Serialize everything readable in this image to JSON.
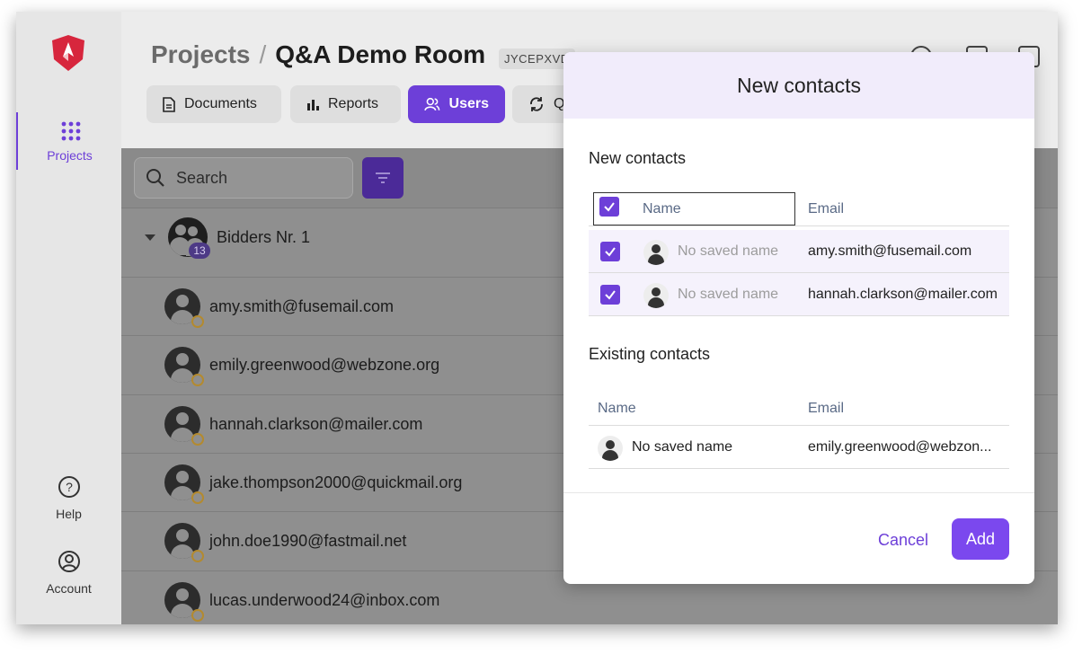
{
  "sidebar": {
    "logo": "shield-logo",
    "items": [
      {
        "label": "Projects",
        "icon": "grid-icon",
        "active": true
      },
      {
        "label": "Help",
        "icon": "help-circle-icon"
      },
      {
        "label": "Account",
        "icon": "account-circle-icon"
      }
    ]
  },
  "header": {
    "breadcrumb_root": "Projects",
    "breadcrumb_sep": "/",
    "room_name": "Q&A Demo Room",
    "room_code": "JYCEPXVD",
    "tabs": [
      {
        "label": "Documents",
        "icon": "document-icon"
      },
      {
        "label": "Reports",
        "icon": "bar-chart-icon"
      },
      {
        "label": "Users",
        "icon": "users-icon",
        "active": true
      },
      {
        "label": "Q",
        "icon": "sync-icon"
      }
    ]
  },
  "toolbar": {
    "search_placeholder": "Search"
  },
  "group": {
    "name": "Bidders Nr. 1",
    "count": "13"
  },
  "users": [
    "amy.smith@fusemail.com",
    "emily.greenwood@webzone.org",
    "hannah.clarkson@mailer.com",
    "jake.thompson2000@quickmail.org",
    "john.doe1990@fastmail.net",
    "lucas.underwood24@inbox.com"
  ],
  "modal": {
    "title": "New contacts",
    "new_section_title": "New contacts",
    "existing_section_title": "Existing contacts",
    "col_name": "Name",
    "col_email": "Email",
    "new_contacts": [
      {
        "name": "No saved name",
        "email": "amy.smith@fusemail.com",
        "checked": true
      },
      {
        "name": "No saved name",
        "email": "hannah.clarkson@mailer.com",
        "checked": true
      }
    ],
    "existing_contacts": [
      {
        "name": "No saved name",
        "email": "emily.greenwood@webzon..."
      }
    ],
    "cancel_label": "Cancel",
    "add_label": "Add"
  },
  "colors": {
    "accent": "#6d3fd8",
    "add_button": "#7b48ee",
    "modal_header_bg": "#f1ecfb",
    "status_ring": "#b38a2f",
    "logo_red": "#d7263d"
  }
}
